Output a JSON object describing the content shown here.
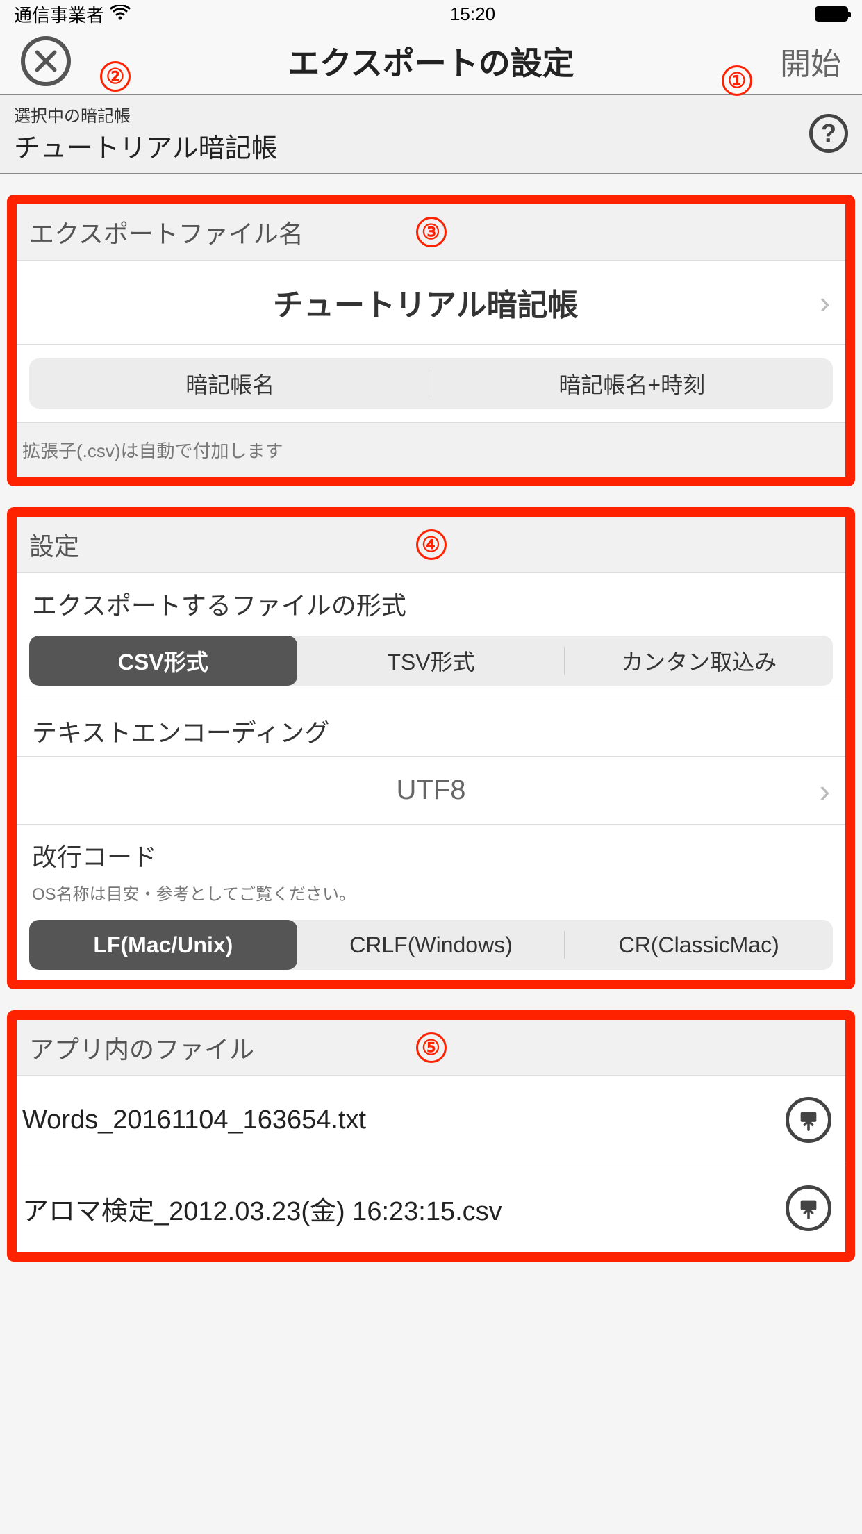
{
  "status": {
    "carrier": "通信事業者",
    "time": "15:20"
  },
  "nav": {
    "title": "エクスポートの設定",
    "start": "開始"
  },
  "markers": {
    "m1": "①",
    "m2": "②",
    "m3": "③",
    "m4": "④",
    "m5": "⑤"
  },
  "subheader": {
    "label": "選択中の暗記帳",
    "value": "チュートリアル暗記帳",
    "help": "?"
  },
  "section1": {
    "title": "エクスポートファイル名",
    "filename": "チュートリアル暗記帳",
    "seg": {
      "a": "暗記帳名",
      "b": "暗記帳名+時刻"
    },
    "note": "拡張子(.csv)は自動で付加します"
  },
  "section2": {
    "title": "設定",
    "format_label": "エクスポートするファイルの形式",
    "format": {
      "csv": "CSV形式",
      "tsv": "TSV形式",
      "kantan": "カンタン取込み"
    },
    "encoding_label": "テキストエンコーディング",
    "encoding_value": "UTF8",
    "newline_label": "改行コード",
    "newline_sub": "OS名称は目安・参考としてご覧ください。",
    "newline": {
      "lf": "LF(Mac/Unix)",
      "crlf": "CRLF(Windows)",
      "cr": "CR(ClassicMac)"
    }
  },
  "section3": {
    "title": "アプリ内のファイル",
    "files": [
      "Words_20161104_163654.txt",
      "アロマ検定_2012.03.23(金) 16:23:15.csv"
    ]
  }
}
